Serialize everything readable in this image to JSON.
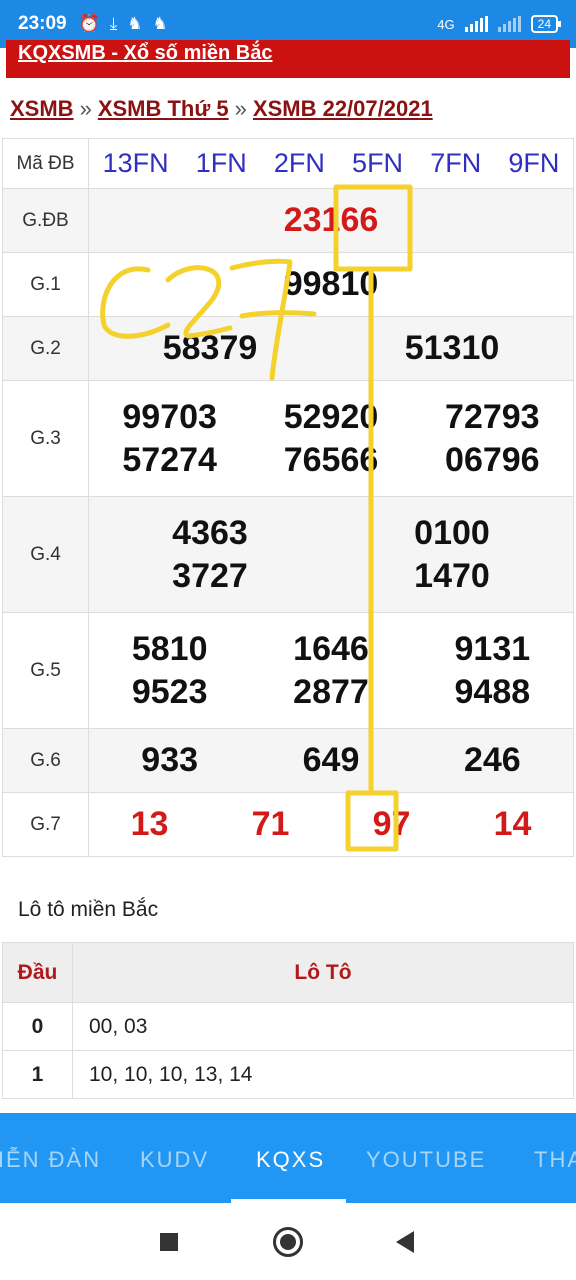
{
  "statusbar": {
    "time": "23:09",
    "network": "4G",
    "battery": "24"
  },
  "banner": {
    "title": "KQXSMB - Xổ số miền Bắc"
  },
  "breadcrumb": {
    "items": [
      "XSMB",
      "XSMB Thứ 5",
      "XSMB 22/07/2021"
    ],
    "separator": "»"
  },
  "results": {
    "code_label": "Mã ĐB",
    "codes": [
      "13FN",
      "1FN",
      "2FN",
      "5FN",
      "7FN",
      "9FN"
    ],
    "rows": [
      {
        "label": "G.ĐB",
        "numbers": [
          "23166"
        ]
      },
      {
        "label": "G.1",
        "numbers": [
          "99810"
        ]
      },
      {
        "label": "G.2",
        "numbers": [
          "58379",
          "51310"
        ]
      },
      {
        "label": "G.3",
        "numbers": [
          "99703",
          "52920",
          "72793",
          "57274",
          "76566",
          "06796"
        ]
      },
      {
        "label": "G.4",
        "numbers": [
          "4363",
          "0100",
          "3727",
          "1470"
        ]
      },
      {
        "label": "G.5",
        "numbers": [
          "5810",
          "1646",
          "9131",
          "9523",
          "2877",
          "9488"
        ]
      },
      {
        "label": "G.6",
        "numbers": [
          "933",
          "649",
          "246"
        ]
      },
      {
        "label": "G.7",
        "numbers": [
          "13",
          "71",
          "97",
          "14"
        ]
      }
    ]
  },
  "loto": {
    "title": "Lô tô miền Bắc",
    "head_label": "Đầu",
    "values_label": "Lô Tô",
    "rows": [
      {
        "head": "0",
        "values": "00, 03"
      },
      {
        "head": "1",
        "values": "10, 10, 10, 13, 14"
      }
    ]
  },
  "bottomnav": {
    "items": [
      "DIỄN ĐÀN",
      "KUDV",
      "KQXS",
      "YOUTUBE",
      "THA"
    ],
    "active": "KQXS"
  },
  "annotation": {
    "handwriting": "C27"
  },
  "colors": {
    "primary": "#2196f3",
    "banner": "#cc1111",
    "special": "#d41919",
    "codes": "#3030c0",
    "highlight": "#f5d12e"
  }
}
